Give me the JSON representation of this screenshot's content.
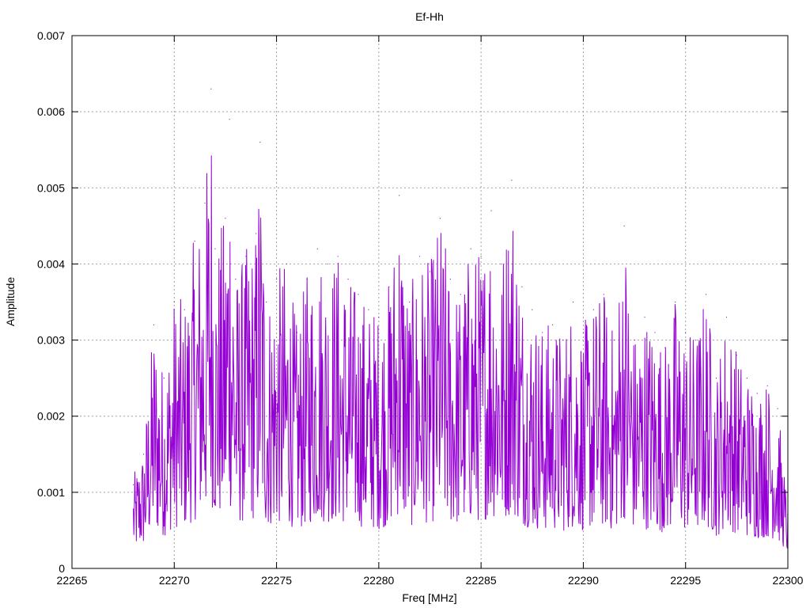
{
  "chart_data": {
    "type": "line",
    "title": "Ef-Hh",
    "xlabel": "Freq [MHz]",
    "ylabel": "Amplitude",
    "xlim": [
      22265,
      22300
    ],
    "ylim": [
      0,
      0.007
    ],
    "x_ticks": [
      22265,
      22270,
      22275,
      22280,
      22285,
      22290,
      22295,
      22300
    ],
    "x_tick_labels": [
      "22265",
      "22270",
      "22275",
      "22280",
      "22285",
      "22290",
      "22295",
      "22300"
    ],
    "y_ticks": [
      0,
      0.001,
      0.002,
      0.003,
      0.004,
      0.005,
      0.006,
      0.007
    ],
    "y_tick_labels": [
      "0",
      "0.001",
      "0.002",
      "0.003",
      "0.004",
      "0.005",
      "0.006",
      "0.007"
    ],
    "grid": true,
    "line_color": "#9400d3",
    "series": [
      {
        "x": [
          22268.0,
          22268.5,
          22269.0,
          22269.5,
          22270.0,
          22270.5,
          22271.0,
          22271.5,
          22271.8,
          22272.0,
          22272.5,
          22272.7,
          22273.0,
          22273.5,
          22274.0,
          22274.2,
          22274.5,
          22275.0,
          22275.5,
          22276.0,
          22276.5,
          22277.0,
          22277.5,
          22278.0,
          22278.5,
          22279.0,
          22279.5,
          22280.0,
          22280.5,
          22281.0,
          22281.5,
          22282.0,
          22282.5,
          22283.0,
          22283.5,
          22284.0,
          22284.5,
          22285.0,
          22285.5,
          22286.0,
          22286.5,
          22287.0,
          22287.5,
          22288.0,
          22288.5,
          22289.0,
          22289.5,
          22290.0,
          22290.5,
          22291.0,
          22291.5,
          22292.0,
          22292.5,
          22293.0,
          22293.5,
          22294.0,
          22294.5,
          22295.0,
          22295.5,
          22296.0,
          22296.5,
          22297.0,
          22297.5,
          22298.0,
          22298.5,
          22299.0,
          22299.5,
          22300.0
        ],
        "y": [
          0.0011,
          0.0015,
          0.0032,
          0.0025,
          0.0035,
          0.0034,
          0.0043,
          0.0048,
          0.0063,
          0.0042,
          0.0046,
          0.0059,
          0.0038,
          0.0041,
          0.0044,
          0.0056,
          0.0035,
          0.0038,
          0.004,
          0.0031,
          0.0038,
          0.0042,
          0.004,
          0.0041,
          0.0038,
          0.0036,
          0.0034,
          0.0033,
          0.0037,
          0.0049,
          0.0035,
          0.0041,
          0.0039,
          0.0046,
          0.0038,
          0.0036,
          0.0042,
          0.0041,
          0.0047,
          0.004,
          0.0051,
          0.0037,
          0.0034,
          0.0031,
          0.0032,
          0.003,
          0.0035,
          0.0031,
          0.0034,
          0.0036,
          0.003,
          0.0045,
          0.003,
          0.0033,
          0.0031,
          0.0029,
          0.0035,
          0.0031,
          0.003,
          0.0036,
          0.0025,
          0.0033,
          0.0028,
          0.0025,
          0.0023,
          0.0024,
          0.0021,
          0.0007
        ]
      }
    ]
  }
}
